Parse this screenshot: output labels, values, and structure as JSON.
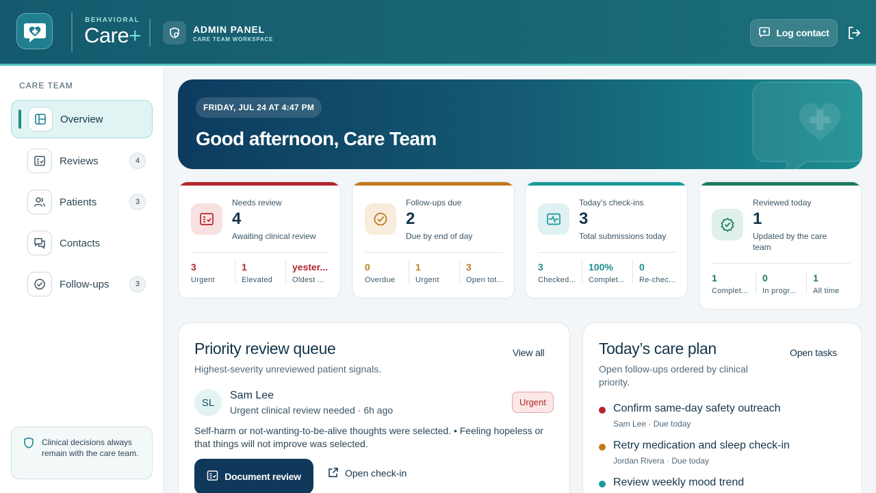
{
  "header": {
    "brand_kicker": "BEHAVIORAL",
    "brand_name": "Care",
    "brand_plus": "+",
    "admin_title": "ADMIN PANEL",
    "admin_subtitle": "CARE TEAM WORKSPACE",
    "log_contact_label": "Log contact",
    "icons": [
      "heart-chat-logo-icon",
      "admin-shield-icon",
      "add-message-icon",
      "logout-icon"
    ]
  },
  "sidebar": {
    "heading": "CARE TEAM",
    "items": [
      {
        "label": "Overview",
        "icon": "layout-icon",
        "badge": "",
        "active": true
      },
      {
        "label": "Reviews",
        "icon": "review-list-icon",
        "badge": "4"
      },
      {
        "label": "Patients",
        "icon": "people-icon",
        "badge": "3"
      },
      {
        "label": "Contacts",
        "icon": "chat-icon",
        "badge": ""
      },
      {
        "label": "Follow-ups",
        "icon": "check-circle-icon",
        "badge": "3"
      }
    ],
    "note": "Clinical decisions always remain with the care team."
  },
  "hero": {
    "date": "FRIDAY, JUL 24 AT 4:47 PM",
    "greeting": "Good afternoon, Care Team"
  },
  "stats": [
    {
      "label": "Needs review",
      "value": "4",
      "desc": "Awaiting clinical review",
      "color": "#b3262a",
      "subs": [
        {
          "v": "3",
          "l": "Urgent"
        },
        {
          "v": "1",
          "l": "Elevated"
        },
        {
          "v": "yester...",
          "l": "Oldest ..."
        }
      ]
    },
    {
      "label": "Follow-ups due",
      "value": "2",
      "desc": "Due by end of day",
      "color": "#c07a1a",
      "subs": [
        {
          "v": "0",
          "l": "Overdue"
        },
        {
          "v": "1",
          "l": "Urgent"
        },
        {
          "v": "3",
          "l": "Open tot..."
        }
      ]
    },
    {
      "label": "Today’s check-ins",
      "value": "3",
      "desc": "Total submissions today",
      "color": "#1a9a9a",
      "subs": [
        {
          "v": "3",
          "l": "Checked..."
        },
        {
          "v": "100%",
          "l": "Complet..."
        },
        {
          "v": "0",
          "l": "Re-chec..."
        }
      ]
    },
    {
      "label": "Reviewed today",
      "value": "1",
      "desc": "Updated by the care team",
      "color": "#1d7a5a",
      "subs": [
        {
          "v": "1",
          "l": "Complet..."
        },
        {
          "v": "0",
          "l": "In progr..."
        },
        {
          "v": "1",
          "l": "All time"
        }
      ]
    }
  ],
  "queue": {
    "title": "Priority review queue",
    "subtitle": "Highest-severity unreviewed patient signals.",
    "view_all": "View all",
    "patient": {
      "initials": "SL",
      "name": "Sam Lee",
      "info": "Urgent clinical review needed · 6h ago",
      "badge": "Urgent",
      "signals": "Self-harm or not-wanting-to-be-alive thoughts were selected.  •  Feeling hopeless or that things will not improve was selected."
    },
    "document_review": "Document review",
    "open_checkin": "Open check-in"
  },
  "careplan": {
    "title": "Today’s care plan",
    "subtitle": "Open follow-ups ordered by clinical priority.",
    "open_tasks": "Open tasks",
    "tasks": [
      {
        "title": "Confirm same-day safety outreach",
        "meta": "Sam Lee · Due today",
        "color": "#b3262a"
      },
      {
        "title": "Retry medication and sleep check-in",
        "meta": "Jordan Rivera · Due today",
        "color": "#c07a1a"
      },
      {
        "title": "Review weekly mood trend",
        "meta": "",
        "color": "#1a9a9a"
      }
    ]
  }
}
